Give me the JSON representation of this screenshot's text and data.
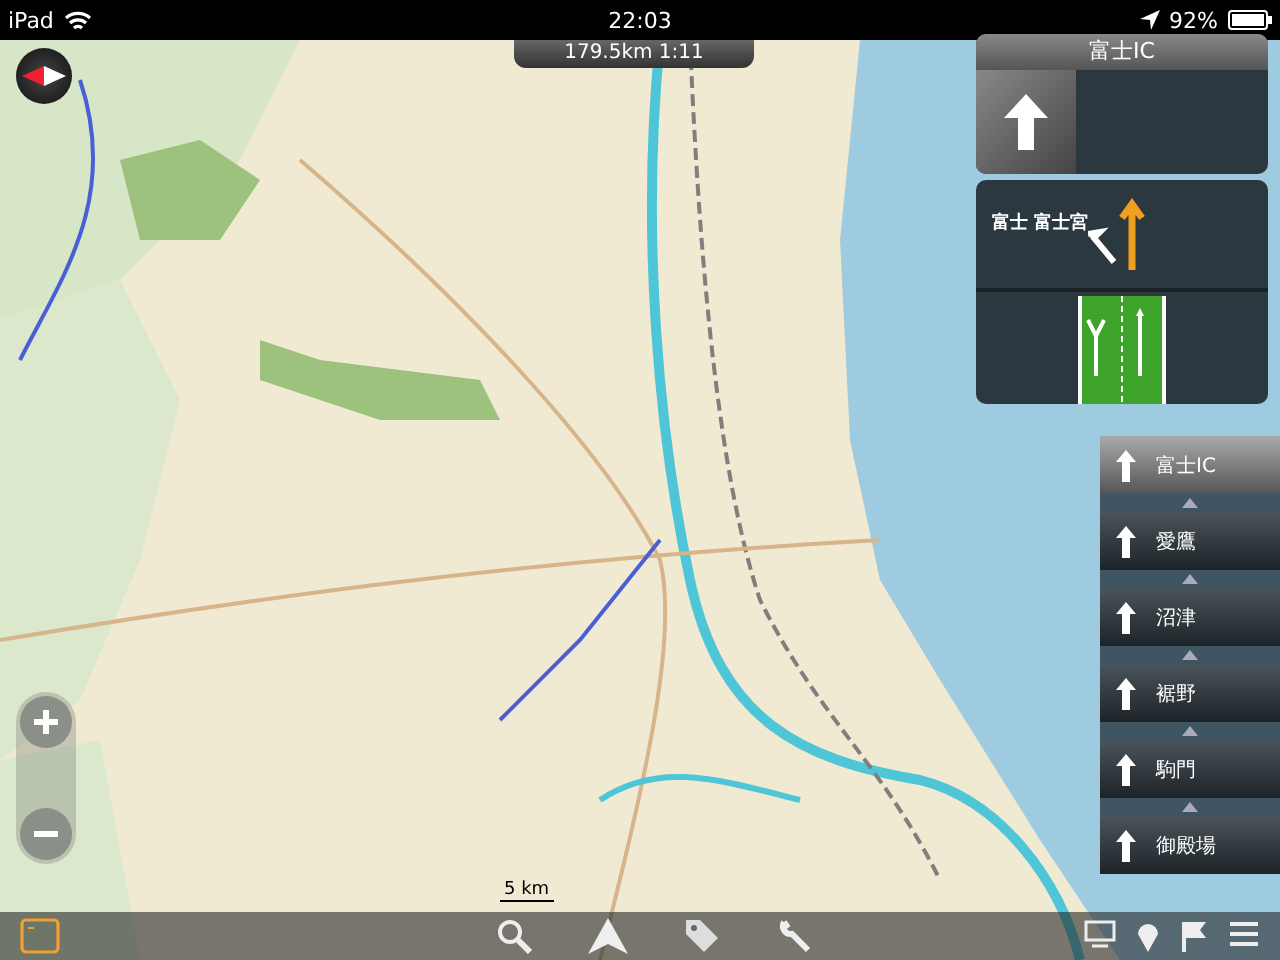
{
  "status_bar": {
    "device": "iPad",
    "time": "22:03",
    "battery": "92%"
  },
  "route_info": "179.5km 1:11",
  "guidance": {
    "title": "富士IC",
    "lane_label": "富士 富士宮"
  },
  "route_list": [
    {
      "label": "富士IC",
      "selected": true
    },
    {
      "label": "愛鷹",
      "selected": false
    },
    {
      "label": "沼津",
      "selected": false
    },
    {
      "label": "裾野",
      "selected": false
    },
    {
      "label": "駒門",
      "selected": false
    },
    {
      "label": "御殿場",
      "selected": false
    }
  ],
  "scale": "5 km",
  "toolbar": [
    {
      "kind": "square"
    },
    {
      "kind": "search"
    },
    {
      "kind": "navigate"
    },
    {
      "kind": "tag"
    },
    {
      "kind": "wrench"
    },
    {
      "kind": "screen"
    },
    {
      "kind": "pin"
    },
    {
      "kind": "flag"
    },
    {
      "kind": "menu"
    }
  ]
}
